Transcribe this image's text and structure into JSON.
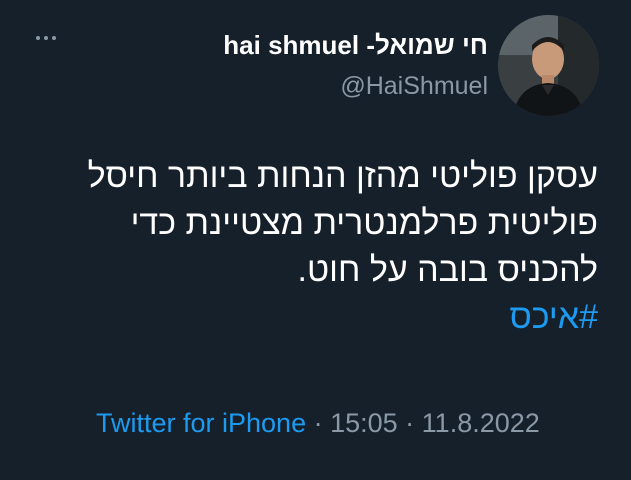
{
  "author": {
    "display_name": "hai shmuel -חי שמואל",
    "handle": "@HaiShmuel"
  },
  "tweet": {
    "lines": [
      "עסקן פוליטי מהזן הנחות ביותר חיסל",
      "פוליטית פרלמנטרית מצטיינת כדי",
      "להכניס בובה על חוט."
    ],
    "hashtag": "#איכס",
    "source": "Twitter for iPhone",
    "separator": " · ",
    "time": "15:05",
    "date": "11.8.2022"
  },
  "icons": {
    "more": "more-horizontal-icon",
    "avatar": "profile-photo"
  },
  "colors": {
    "background": "#15202b",
    "accent": "#1d9bf0",
    "secondary_text": "#8b98a5",
    "primary_text": "#ffffff"
  }
}
